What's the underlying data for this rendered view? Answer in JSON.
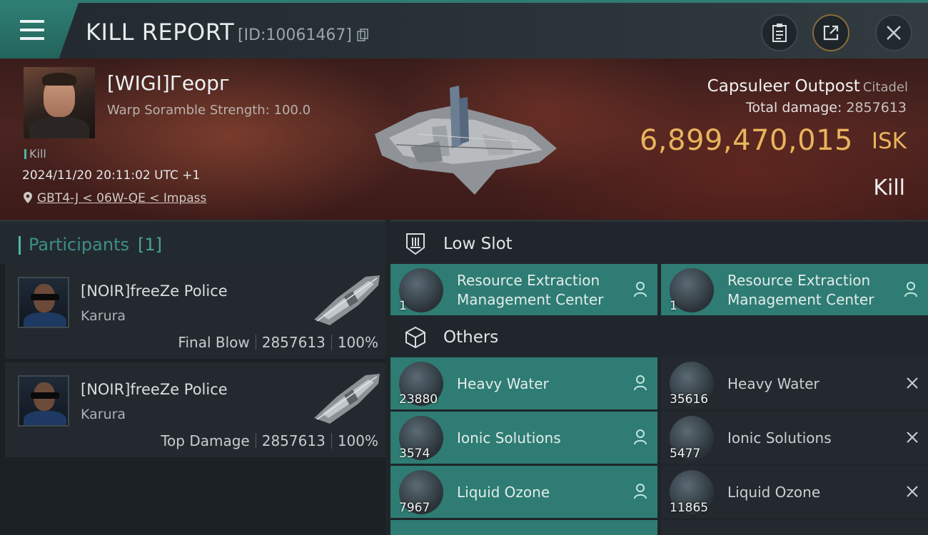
{
  "header": {
    "title": "KILL REPORT",
    "report_id": "[ID:10061467]",
    "icons": [
      "menu-icon",
      "copy-icon",
      "clipboard-icon",
      "share-icon",
      "close-icon"
    ]
  },
  "victim": {
    "name": "[WIGI]Георг",
    "scramble": "Warp Soramble Strength: 100.0",
    "tag": "Kill",
    "datetime": "2024/11/20 20:11:02 UTC +1",
    "location": "GBT4-J < 06W-QE < Impass",
    "structure": "Capsuleer Outpost",
    "structure_class": "Citadel",
    "total_damage_label": "Total damage:",
    "total_damage": "2857613",
    "isk_value": "6,899,470,015",
    "isk_unit": "ISK",
    "result": "Kill"
  },
  "participants": {
    "title": "Participants",
    "count": "[1]",
    "rows": [
      {
        "name": "[NOIR]freeZe Police",
        "ship": "Karura",
        "role": "Final Blow",
        "damage": "2857613",
        "percent": "100%"
      },
      {
        "name": "[NOIR]freeZe Police",
        "ship": "Karura",
        "role": "Top Damage",
        "damage": "2857613",
        "percent": "100%"
      }
    ]
  },
  "low_slot": {
    "title": "Low Slot",
    "items": [
      {
        "line1": "Resource Extraction",
        "line2": "Management Center",
        "qty": "1"
      },
      {
        "line1": "Resource Extraction",
        "line2": "Management Center",
        "qty": "1"
      }
    ]
  },
  "others": {
    "title": "Others",
    "items": [
      {
        "name": "Heavy Water",
        "qty": "23880",
        "state": "dropped"
      },
      {
        "name": "Heavy Water",
        "qty": "35616",
        "state": "destroyed"
      },
      {
        "name": "Ionic Solutions",
        "qty": "3574",
        "state": "dropped"
      },
      {
        "name": "Ionic Solutions",
        "qty": "5477",
        "state": "destroyed"
      },
      {
        "name": "Liquid Ozone",
        "qty": "7967",
        "state": "dropped"
      },
      {
        "name": "Liquid Ozone",
        "qty": "11865",
        "state": "destroyed"
      }
    ]
  },
  "colors": {
    "accent": "#2e7c73",
    "isk": "#e8b45c"
  }
}
